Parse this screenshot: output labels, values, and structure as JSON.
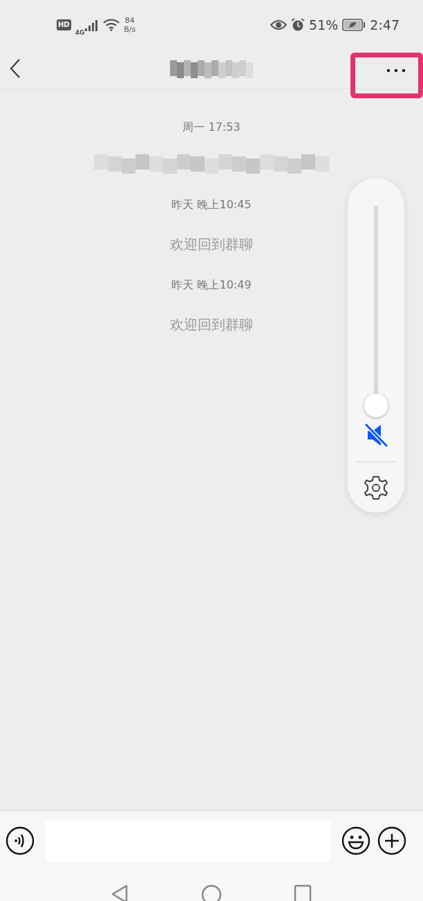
{
  "status_bar": {
    "hd": "HD",
    "network_type": "4G",
    "net_speed": "84",
    "net_unit": "B/s",
    "battery": "51%",
    "time": "2:47"
  },
  "header": {
    "title": {
      "kind": "redacted"
    },
    "highlight": {
      "color": "#e0336f"
    }
  },
  "messages": [
    {
      "kind": "time",
      "text": "周一 17:53"
    },
    {
      "kind": "redacted"
    },
    {
      "kind": "time",
      "text": "昨天 晚上10:45"
    },
    {
      "kind": "notice",
      "text": "欢迎回到群聊"
    },
    {
      "kind": "time",
      "text": "昨天 晚上10:49"
    },
    {
      "kind": "notice",
      "text": "欢迎回到群聊"
    }
  ],
  "volume_panel": {
    "level": 0,
    "muted": true
  }
}
